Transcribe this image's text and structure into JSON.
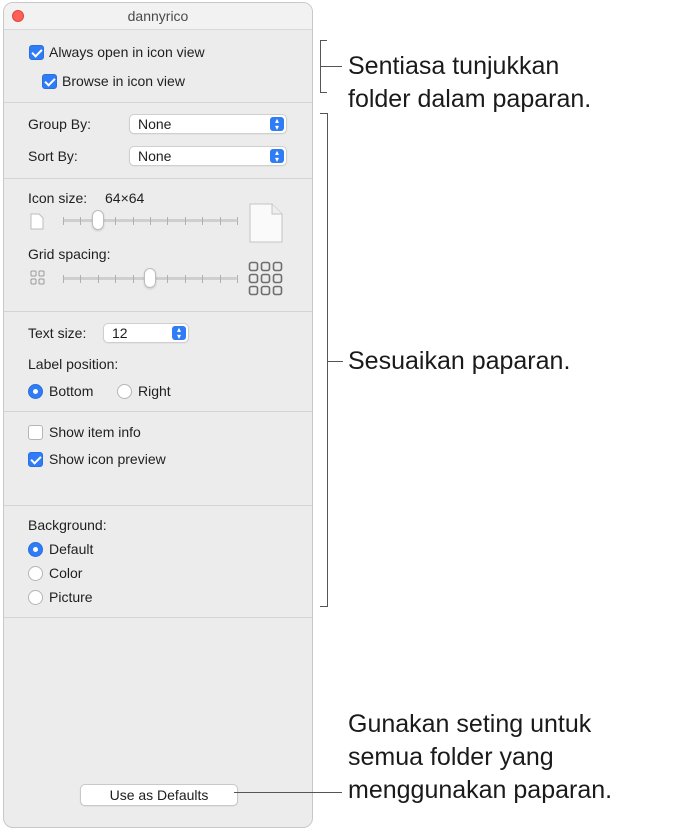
{
  "window": {
    "title": "dannyrico"
  },
  "options": {
    "always_open_icon_view": "Always open in icon view",
    "browse_icon_view": "Browse in icon view"
  },
  "group_by": {
    "label": "Group By:",
    "value": "None"
  },
  "sort_by": {
    "label": "Sort By:",
    "value": "None"
  },
  "icon_size": {
    "label": "Icon size:",
    "value": "64×64",
    "slider_level": 0.2
  },
  "grid_spacing": {
    "label": "Grid spacing:",
    "slider_level": 0.5
  },
  "text_size": {
    "label": "Text size:",
    "value": "12"
  },
  "label_position": {
    "label": "Label position:",
    "bottom": "Bottom",
    "right": "Right",
    "selected": "Bottom"
  },
  "item_info": {
    "show_item_info": "Show item info",
    "show_item_info_checked": false,
    "show_icon_preview": "Show icon preview",
    "show_icon_preview_checked": true
  },
  "background": {
    "label": "Background:",
    "default": "Default",
    "color": "Color",
    "picture": "Picture",
    "selected": "Default"
  },
  "defaults_button": "Use as Defaults",
  "callouts": {
    "first": [
      "Sentiasa tunjukkan",
      "folder dalam paparan."
    ],
    "second": "Sesuaikan paparan.",
    "third": [
      "Gunakan seting untuk",
      "semua folder yang",
      "menggunakan paparan."
    ]
  },
  "colors": {
    "accent": "#2f7cf6",
    "close": "#ff5f57"
  }
}
